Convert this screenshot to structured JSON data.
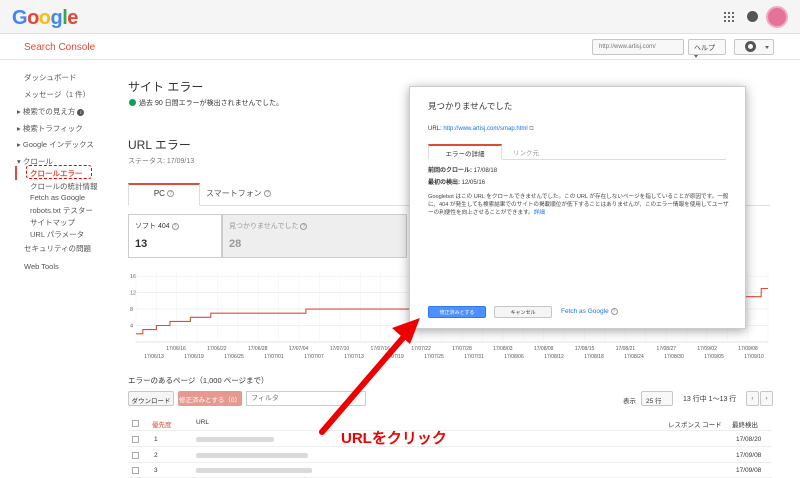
{
  "header": {
    "logo_letters": [
      "G",
      "o",
      "o",
      "g",
      "l",
      "e"
    ],
    "logo_colors": [
      "#4285f4",
      "#ea4335",
      "#fbbc05",
      "#4285f4",
      "#34a853",
      "#ea4335"
    ],
    "app_name": "Search Console",
    "site_selector": "http://www.artisj.com/",
    "help_label": "ヘルプ"
  },
  "sidebar": {
    "items": [
      {
        "label": "ダッシュボード",
        "arrow": ""
      },
      {
        "label": "メッセージ（1 件）",
        "arrow": ""
      },
      {
        "label": "検索での見え方",
        "arrow": "▸"
      },
      {
        "label": "検索トラフィック",
        "arrow": "▸"
      },
      {
        "label": "Google インデックス",
        "arrow": "▸"
      },
      {
        "label": "クロール",
        "arrow": "▾"
      },
      {
        "label": "クロールエラー",
        "arrow": ""
      },
      {
        "label": "クロールの統計情報",
        "arrow": ""
      },
      {
        "label": "Fetch as Google",
        "arrow": ""
      },
      {
        "label": "robots.txt テスター",
        "arrow": ""
      },
      {
        "label": "サイトマップ",
        "arrow": ""
      },
      {
        "label": "URL パラメータ",
        "arrow": ""
      },
      {
        "label": "セキュリティの問題",
        "arrow": ""
      },
      {
        "label": "Web Tools",
        "arrow": ""
      }
    ]
  },
  "main": {
    "site_errors_title": "サイト エラー",
    "site_errors_status": "過去 90 日間エラーが検出されませんでした。",
    "url_errors_title": "URL エラー",
    "status_line": "ステータス: 17/09/13",
    "tabs": [
      {
        "label": "PC"
      },
      {
        "label": "スマートフォン"
      }
    ],
    "counters": [
      {
        "label": "ソフト 404",
        "value": "13"
      },
      {
        "label": "見つかりませんでした",
        "value": "28"
      }
    ],
    "table_title": "エラーのあるページ（1,000 ページまで）",
    "download_label": "ダウンロード",
    "mark_fixed_label": "修正済みとする（0）",
    "filter_placeholder": "フィルタ",
    "show_label": "表示",
    "rows_per_page": "25 行",
    "pagination": "13 行中 1～13 行",
    "columns": [
      "優先度",
      "URL",
      "レスポンス コード",
      "最終検出"
    ],
    "rows": [
      {
        "priority": "1",
        "date": "17/08/20"
      },
      {
        "priority": "2",
        "date": "17/09/08"
      },
      {
        "priority": "3",
        "date": "17/09/08"
      }
    ]
  },
  "dialog": {
    "title": "見つかりませんでした",
    "url_label": "URL:",
    "url_value": "http://www.artisj.com/smap.html",
    "tab_details": "エラーの詳細",
    "tab_links": "リンク元",
    "last_crawl_label": "前回のクロール:",
    "last_crawl_value": "17/08/18",
    "first_detected_label": "最初の検出:",
    "first_detected_value": "12/05/16",
    "description": "Googlebot はこの URL をクロールできませんでした。この URL が存在しないページを指していることが原因です。一般に、404 が発生しても検索結果でのサイトの掲載順位が低下することはありませんが、このエラー情報を使用してユーザーの利便性を向上させることができます。",
    "more_link": "詳細",
    "mark_fixed_button": "修正済みとする",
    "cancel_button": "キャンセル",
    "fetch_link": "Fetch as Google"
  },
  "annotation": {
    "text": "URLをクリック",
    "color": "#ee0000"
  },
  "chart_data": {
    "type": "line",
    "series": [
      {
        "name": "",
        "color": "#dd4b39"
      }
    ],
    "y_ticks": [
      "4",
      "8",
      "12",
      "16"
    ],
    "ylim": [
      0,
      17
    ],
    "x_ticks_upper": [
      "17/06/16",
      "17/06/22",
      "17/06/28",
      "17/07/04",
      "17/07/10",
      "17/07/16",
      "17/07/22",
      "17/07/28",
      "17/08/03",
      "17/08/09",
      "17/08/15",
      "17/08/21",
      "17/08/27",
      "17/09/02",
      "17/09/08"
    ],
    "x_ticks_lower": [
      "17/06/13",
      "17/06/19",
      "17/06/25",
      "17/07/01",
      "17/07/07",
      "17/07/13",
      "17/07/19",
      "17/07/25",
      "17/07/31",
      "17/08/06",
      "17/08/12",
      "17/08/18",
      "17/08/24",
      "17/08/30",
      "17/09/05",
      "17/09/10"
    ],
    "grid": true,
    "values": [
      2,
      3,
      3,
      4,
      4,
      5,
      5,
      5,
      6,
      6,
      6,
      7,
      7,
      7,
      7,
      7,
      7,
      7,
      7,
      7,
      7,
      7,
      7,
      7,
      7,
      8,
      8,
      8,
      8,
      8,
      8,
      8,
      8,
      8,
      8,
      8,
      8,
      8,
      8,
      8,
      8,
      8,
      8,
      8,
      8,
      8,
      8,
      8,
      8,
      8,
      8,
      8,
      8,
      8,
      8,
      8,
      8,
      8,
      8,
      8,
      8,
      8,
      8,
      8,
      8,
      8,
      8,
      8,
      8,
      8,
      8,
      8,
      8,
      8,
      8,
      8,
      8,
      8,
      8,
      8,
      8,
      8,
      8,
      8,
      8,
      8,
      10,
      10,
      11,
      11,
      11,
      11,
      13,
      13
    ]
  }
}
